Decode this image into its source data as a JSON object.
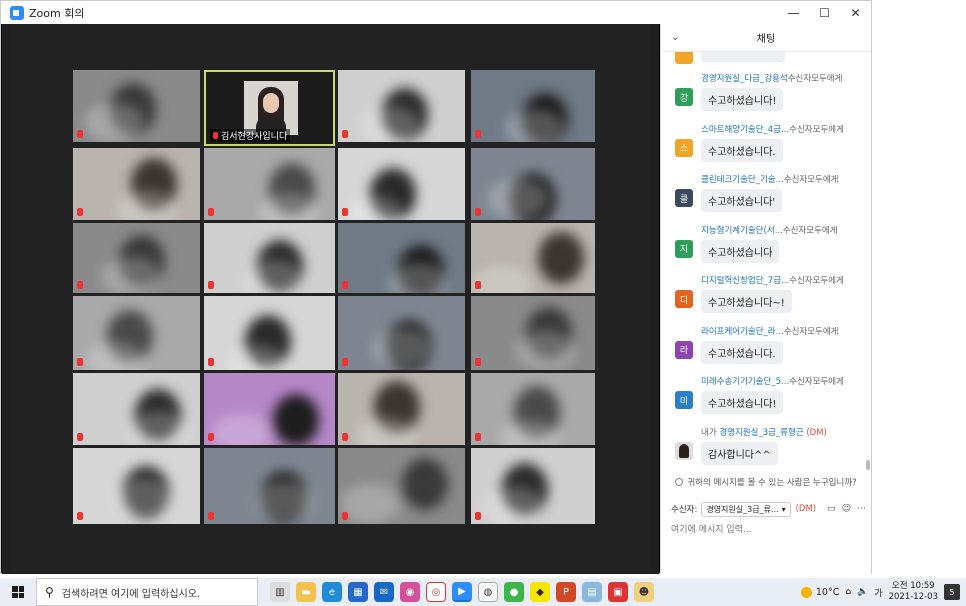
{
  "window": {
    "title": "Zoom 회의",
    "min": "—",
    "max": "☐",
    "close": "✕"
  },
  "speaker": {
    "name": "김서현강사입니다"
  },
  "chat": {
    "title": "채팅",
    "collapse": "⌄",
    "messages": [
      {
        "sender": "경영지원실_다급_강용석",
        "to": "수신자모두에게",
        "avatar": "강",
        "color": "#2e9e5b",
        "text": "수고하셨습니다!"
      },
      {
        "sender": "스마트해양기술단_4급...",
        "to": "수신자모두에게",
        "avatar": "스",
        "color": "#f2a427",
        "text": "수고하셨습니다."
      },
      {
        "sender": "클린테크기술단_기술...",
        "to": "수신자모두에게",
        "avatar": "클",
        "color": "#3a4a5c",
        "text": "수고하셨습니다'"
      },
      {
        "sender": "지능형기계기술단(서...",
        "to": "수신자모두에게",
        "avatar": "지",
        "color": "#2e9e5b",
        "text": "수고하셨습니다"
      },
      {
        "sender": "디지털혁신창업단_7급...",
        "to": "수신자모두에게",
        "avatar": "디",
        "color": "#e2641e",
        "text": "수고하셨습니다~!"
      },
      {
        "sender": "라이프케어기술단_라...",
        "to": "수신자모두에게",
        "avatar": "라",
        "color": "#8e44ad",
        "text": "수고하셨습니다."
      },
      {
        "sender": "미래수송기기기술단_5...",
        "to": "수신자모두에게",
        "avatar": "미",
        "color": "#2a7fc9",
        "text": "수고하셨습니다!"
      }
    ],
    "own_message": {
      "prefix": "내가",
      "recipient": "경영지원실_3급_류형근",
      "dm": "(DM)",
      "text": "감사합니다^^"
    },
    "privacy_notice": "귀하의 메시지를 볼 수 있는 사람은 누구입니까?",
    "recipient_label": "수신자:",
    "recipient_value": "경영지원실_3급_류...",
    "recipient_dm": "(DM)",
    "input_placeholder": "여기에 메시지 입력..."
  },
  "taskbar": {
    "search_placeholder": "검색하려면 여기에 입력하십시오.",
    "weather": "10°C",
    "ime": "가",
    "time": "오전 10:59",
    "date": "2021-12-03",
    "notifications": "5"
  },
  "icons": [
    "search-icon",
    "task-view-icon",
    "file-explorer-icon",
    "edge-icon",
    "store-icon",
    "mail-icon",
    "zoom-icon",
    "chrome-icon",
    "kakaotalk-icon",
    "powerpoint-icon"
  ]
}
